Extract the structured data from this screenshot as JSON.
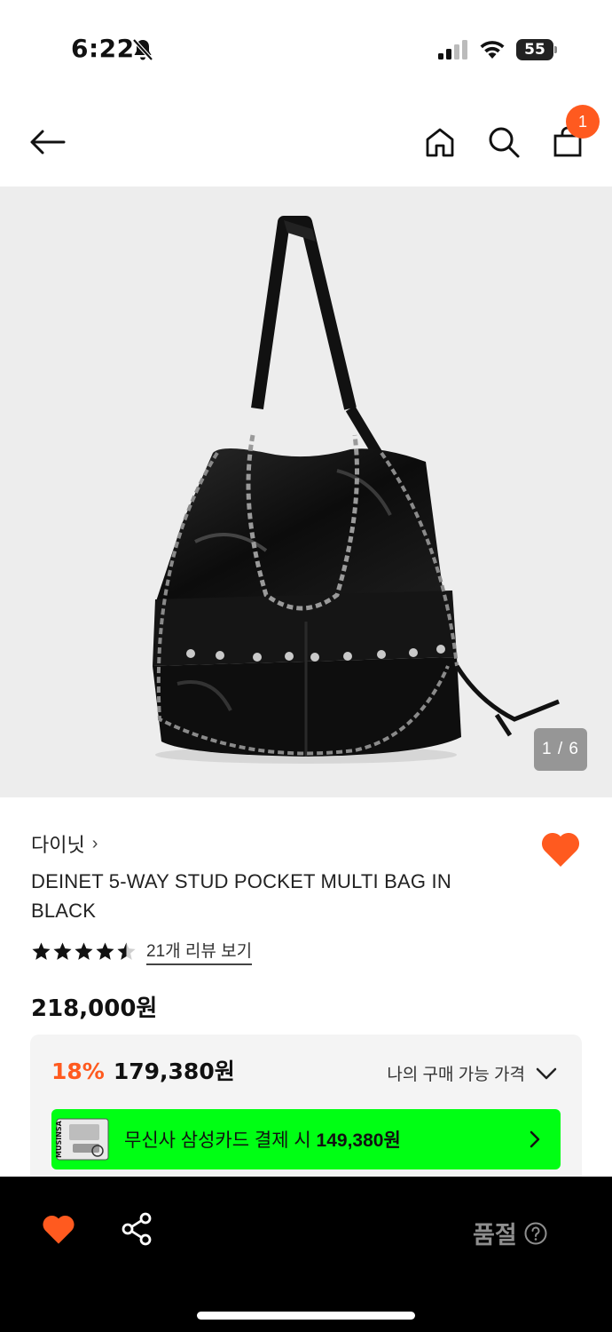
{
  "status_bar": {
    "time": "6:22",
    "battery": "55"
  },
  "nav": {
    "cart_count": "1"
  },
  "image": {
    "counter": "1 / 6"
  },
  "product": {
    "brand": "다이닛",
    "brand_chevron": "›",
    "title": "DEINET 5-WAY STUD POCKET MULTI BAG IN BLACK",
    "rating": 4.5,
    "review_link": "21개 리뷰 보기",
    "original_price": "218,000원"
  },
  "price_box": {
    "discount": "18%",
    "sale_price": "179,380원",
    "my_price_label": "나의 구매 가능 가격",
    "card_text_prefix": "무신사 삼성카드 결제 시",
    "card_price": "149,380원",
    "card_brand": "MUSINSA"
  },
  "bottom_bar": {
    "soldout_label": "품절"
  },
  "colors": {
    "accent": "#ff5a1f",
    "card_green": "#00ff14",
    "image_bg": "#ededed"
  },
  "icons": [
    "back-arrow-icon",
    "home-icon",
    "search-icon",
    "cart-icon",
    "heart-icon",
    "star-icon",
    "chevron-down-icon",
    "chevron-right-icon",
    "share-icon",
    "help-icon"
  ]
}
